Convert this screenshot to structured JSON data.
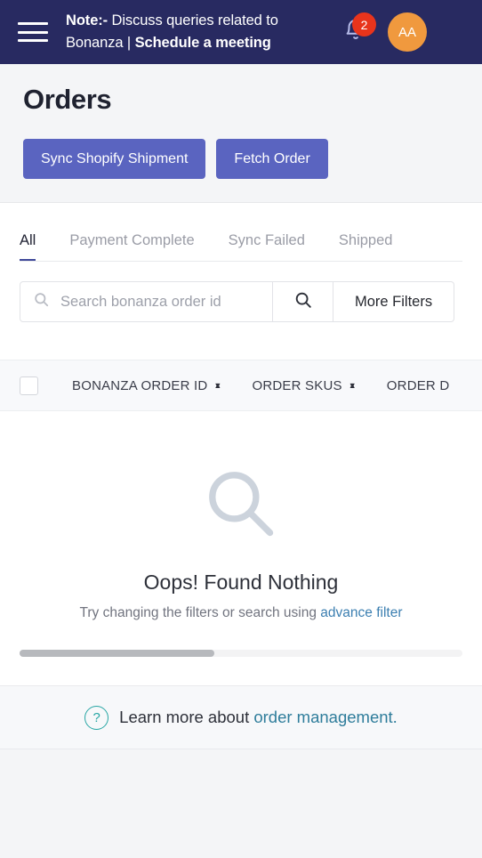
{
  "topbar": {
    "menu_icon": "hamburger-menu-icon",
    "note_prefix": "Note:-",
    "note_text": " Discuss queries related to Bonanza | ",
    "note_link": "Schedule a meeting",
    "notification_icon": "bell-icon",
    "notification_count": "2",
    "avatar_initials": "AA",
    "bg_color": "#282a61",
    "badge_color": "#e8341c",
    "avatar_color": "#f0993e"
  },
  "page": {
    "title": "Orders",
    "buttons": [
      {
        "label": "Sync Shopify Shipment",
        "name": "sync-shopify-shipment-button"
      },
      {
        "label": "Fetch Order",
        "name": "fetch-order-button"
      }
    ],
    "primary_color": "#5a64c0"
  },
  "tabs": [
    {
      "label": "All",
      "active": true
    },
    {
      "label": "Payment Complete",
      "active": false
    },
    {
      "label": "Sync Failed",
      "active": false
    },
    {
      "label": "Shipped",
      "active": false
    }
  ],
  "search": {
    "placeholder": "Search bonanza order id",
    "value": "",
    "search_icon": "search-icon",
    "search_button_icon": "search-icon",
    "more_filters_label": "More Filters"
  },
  "table": {
    "select_all": "",
    "columns": [
      {
        "label": "BONANZA ORDER ID",
        "sortable": true
      },
      {
        "label": "ORDER SKUS",
        "sortable": true
      },
      {
        "label": "ORDER D",
        "sortable": false
      }
    ]
  },
  "empty_state": {
    "icon": "magnifier-icon",
    "title": "Oops! Found Nothing",
    "subtitle": "Try changing the filters or search using ",
    "link": "advance filter"
  },
  "scrollbar": {
    "thumb_percent": "44"
  },
  "footer": {
    "help_icon": "question-circle-icon",
    "text": "Learn more about ",
    "link": "order management.",
    "link_color": "#2f7d9b"
  }
}
